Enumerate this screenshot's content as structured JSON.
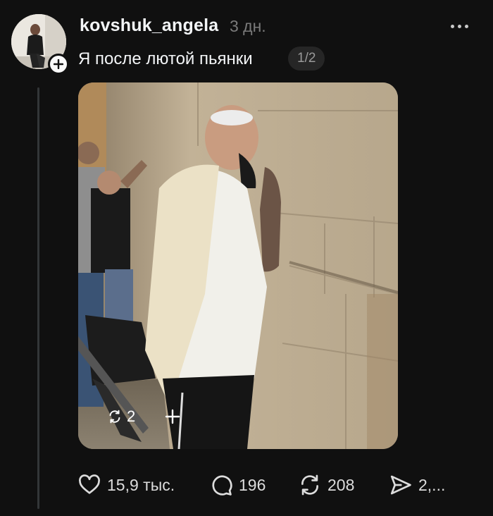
{
  "post": {
    "username": "kovshuk_angela",
    "time_ago": "3 дн.",
    "caption": "Я после лютой пьянки",
    "media_counter": "1/2",
    "media_overlay": {
      "repost_count": "2"
    }
  },
  "actions": {
    "likes": "15,9 тыс.",
    "comments": "196",
    "reposts": "208",
    "shares": "2,..."
  },
  "icons": {
    "follow": "plus-icon",
    "more": "more-horizontal-icon",
    "like": "heart-icon",
    "comment": "comment-bubble-icon",
    "repost": "repost-arrows-icon",
    "share": "send-icon"
  },
  "colors": {
    "background": "#101010",
    "text": "#f3f5f7",
    "muted": "#7a7a7a",
    "badge": "#262626"
  }
}
